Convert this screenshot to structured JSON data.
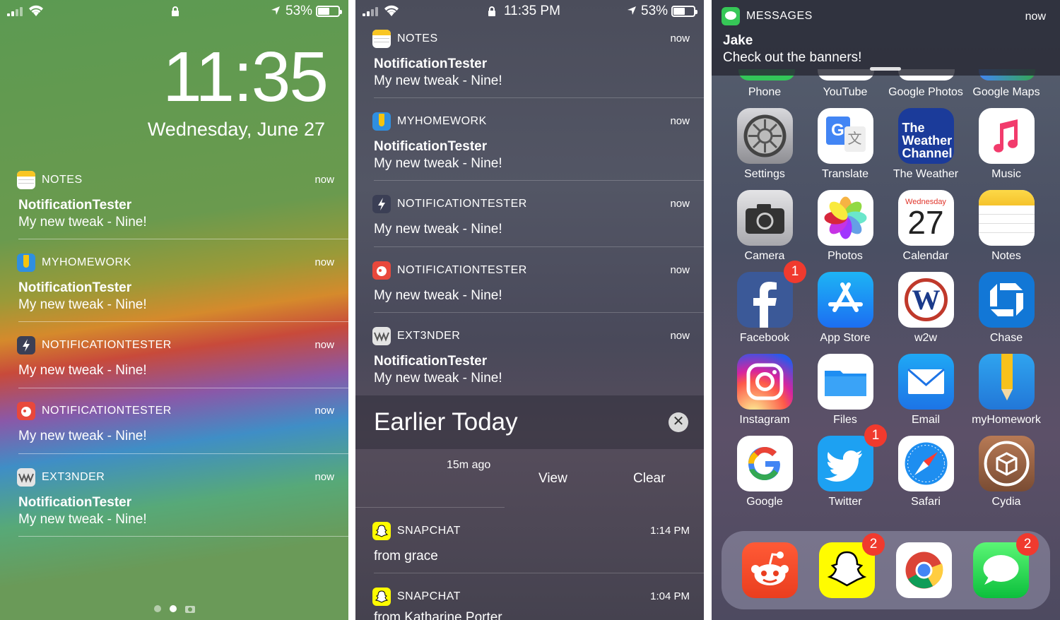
{
  "lockscreen": {
    "status": {
      "battery": "53%"
    },
    "time": "11:35",
    "date": "Wednesday, June 27",
    "notifications": [
      {
        "app": "NOTES",
        "when": "now",
        "title": "NotificationTester",
        "body": "My new tweak - Nine!"
      },
      {
        "app": "MYHOMEWORK",
        "when": "now",
        "title": "NotificationTester",
        "body": "My new tweak - Nine!"
      },
      {
        "app": "NOTIFICATIONTESTER",
        "when": "now",
        "title": "",
        "body": "My new tweak - Nine!"
      },
      {
        "app": "NOTIFICATIONTESTER",
        "when": "now",
        "title": "",
        "body": "My new tweak - Nine!"
      },
      {
        "app": "EXT3NDER",
        "when": "now",
        "title": "NotificationTester",
        "body": "My new tweak - Nine!"
      }
    ]
  },
  "center": {
    "status": {
      "time": "11:35 PM",
      "battery": "53%"
    },
    "notifications": [
      {
        "app": "NOTES",
        "when": "now",
        "title": "NotificationTester",
        "body": "My new tweak - Nine!"
      },
      {
        "app": "MYHOMEWORK",
        "when": "now",
        "title": "NotificationTester",
        "body": "My new tweak - Nine!"
      },
      {
        "app": "NOTIFICATIONTESTER",
        "when": "now",
        "title": "",
        "body": "My new tweak - Nine!"
      },
      {
        "app": "NOTIFICATIONTESTER",
        "when": "now",
        "title": "",
        "body": "My new tweak - Nine!"
      },
      {
        "app": "EXT3NDER",
        "when": "now",
        "title": "NotificationTester",
        "body": "My new tweak - Nine!"
      }
    ],
    "earlier": {
      "heading": "Earlier Today",
      "close": "✕",
      "ago": "15m ago",
      "view": "View",
      "clear": "Clear"
    },
    "older": [
      {
        "app": "SNAPCHAT",
        "when": "1:14 PM",
        "body": "from grace"
      },
      {
        "app": "SNAPCHAT",
        "when": "1:04 PM",
        "body": "from Katharine Porter"
      }
    ]
  },
  "home": {
    "banner": {
      "app": "MESSAGES",
      "when": "now",
      "title": "Jake",
      "body": "Check out the banners!"
    },
    "top_row": [
      "Phone",
      "YouTube",
      "Google Photos",
      "Google Maps"
    ],
    "grid": [
      [
        "Settings",
        "Translate",
        "The Weather",
        "Music"
      ],
      [
        "Camera",
        "Photos",
        "Calendar",
        "Notes"
      ],
      [
        "Facebook",
        "App Store",
        "w2w",
        "Chase"
      ],
      [
        "Instagram",
        "Files",
        "Email",
        "myHomework"
      ],
      [
        "Google",
        "Twitter",
        "Safari",
        "Cydia"
      ]
    ],
    "badges": {
      "facebook": "1",
      "twitter": "1",
      "snapchat": "2",
      "messages": "2"
    },
    "weather_icon_text": [
      "The",
      "Weather",
      "Channel"
    ],
    "calendar": {
      "day": "Wednesday",
      "num": "27"
    },
    "dock": [
      "reddit",
      "snapchat",
      "chrome",
      "messages"
    ]
  }
}
